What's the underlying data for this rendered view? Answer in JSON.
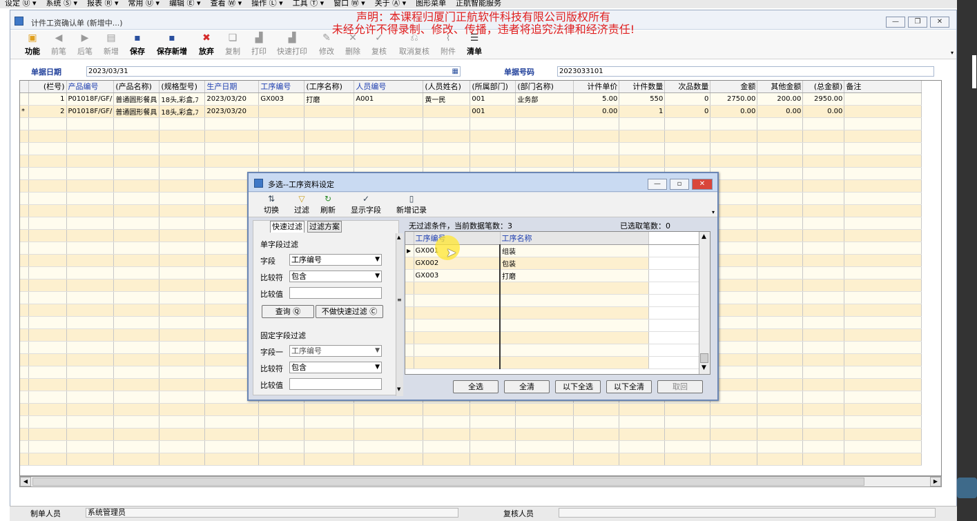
{
  "menubar": [
    "设定 Ⓤ ▾",
    "系统 Ⓢ ▾",
    "报表 Ⓡ ▾",
    "常用 Ⓤ ▾",
    "编辑 Ⓔ ▾",
    "查看 Ⓦ ▾",
    "操作 Ⓛ ▾",
    "工具 Ⓣ ▾",
    "窗口 Ⓦ ▾",
    "关于 Ⓐ ▾",
    "图形菜单",
    "正航智能服务"
  ],
  "window": {
    "title": "计件工资确认单 (新增中...)"
  },
  "notice": {
    "line1": "声明：本课程归厦门正航软件科技有限公司版权所有",
    "line2": "未经允许不得录制、修改、传播，违者将追究法律和经济责任!"
  },
  "toolbar": {
    "function": "功能",
    "prev": "前笔",
    "next": "后笔",
    "new": "新增",
    "save": "保存",
    "save_new": "保存新增",
    "discard": "放弃",
    "copy": "复制",
    "print": "打印",
    "quick_print": "快速打印",
    "modify": "修改",
    "delete": "删除",
    "review": "复核",
    "cancel_review": "取消复核",
    "attach": "附件",
    "clear": "清单"
  },
  "header": {
    "date_label": "单据日期",
    "date_value": "2023/03/31",
    "no_label": "单据号码",
    "no_value": "2023033101"
  },
  "grid": {
    "columns": [
      "(栏号)",
      "产品编号",
      "(产品名称)",
      "(规格型号)",
      "生产日期",
      "工序编号",
      "(工序名称)",
      "人员编号",
      "(人员姓名)",
      "(所属部门)",
      "(部门名称)",
      "计件单价",
      "计件数量",
      "次品数量",
      "金额",
      "其他金额",
      "(总金额)",
      "备注"
    ],
    "rows": [
      [
        "1",
        "P01018F/GF/",
        "普通圆形餐具",
        "18头,彩盒,ﾌ",
        "2023/03/20",
        "GX003",
        "打磨",
        "A001",
        "黄一民",
        "001",
        "业务部",
        "5.00",
        "550",
        "0",
        "2750.00",
        "200.00",
        "2950.00",
        ""
      ],
      [
        "2",
        "P01018F/GF/",
        "普通圆形餐具",
        "18头,彩盒,ﾌ",
        "2023/03/20",
        "",
        "",
        "",
        "",
        "001",
        "",
        "0.00",
        "1",
        "0",
        "0.00",
        "0.00",
        "0.00",
        ""
      ]
    ],
    "current_marker": "*"
  },
  "status": {
    "maker_label": "制单人员",
    "maker_value": "系统管理员",
    "reviewer_label": "复核人员"
  },
  "dialog": {
    "title": "多选--工序资料设定",
    "tools": {
      "switch": "切换",
      "filter": "过滤",
      "refresh": "刷新",
      "show_fields": "显示字段",
      "new_record": "新增记录"
    },
    "tabs": {
      "quick": "快速过滤",
      "scheme": "过滤方案"
    },
    "single": {
      "heading": "单字段过滤",
      "field_label": "字段",
      "field_value": "工序编号",
      "cmp_label": "比较符",
      "cmp_value": "包含",
      "val_label": "比较值",
      "query_btn": "查询 Ⓠ",
      "noquick_btn": "不做快速过滤 Ⓒ"
    },
    "fixed": {
      "heading": "固定字段过滤",
      "field_label": "字段一",
      "field_value": "工序编号",
      "cmp_label": "比较符",
      "cmp_value": "包含",
      "val_label": "比较值"
    },
    "info_left": "无过滤条件，当前数据笔数：3",
    "info_right": "已选取笔数：0",
    "list": {
      "columns": [
        "工序编号",
        "工序名称"
      ],
      "rows": [
        [
          "GX001",
          "组装"
        ],
        [
          "GX002",
          "包装"
        ],
        [
          "GX003",
          "打磨"
        ]
      ]
    },
    "buttons": {
      "select_all": "全选",
      "clear_all": "全清",
      "select_below": "以下全选",
      "clear_below": "以下全清",
      "cancel": "取回"
    }
  }
}
